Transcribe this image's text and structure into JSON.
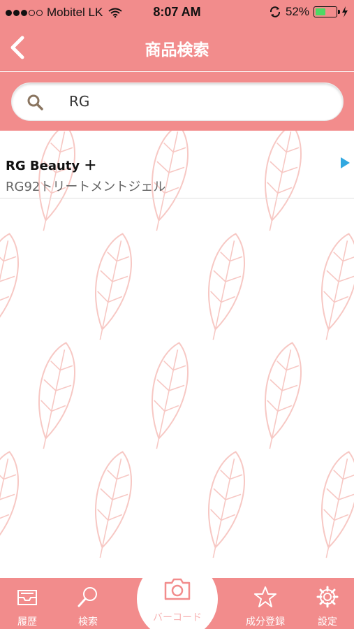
{
  "status_bar": {
    "carrier": "Mobitel LK",
    "time": "8:07 AM",
    "battery_percent": "52%",
    "battery_level": 0.52,
    "signal_bars": 3,
    "signal_max": 5
  },
  "nav": {
    "title": "商品検索",
    "back_icon": "chevron-left-icon"
  },
  "search": {
    "value": "RG",
    "icon": "search-icon"
  },
  "results": [
    {
      "brand": "RG Beauty ＋",
      "product": "RG92トリートメントジェル"
    }
  ],
  "tabs": [
    {
      "label": "履歴",
      "icon": "inbox-tray-icon"
    },
    {
      "label": "検索",
      "icon": "search-icon"
    },
    {
      "label": "バーコード",
      "icon": "camera-icon"
    },
    {
      "label": "成分登録",
      "icon": "star-icon"
    },
    {
      "label": "設定",
      "icon": "gear-icon"
    }
  ],
  "colors": {
    "accent": "#f28c8c",
    "arrow": "#31a8e0",
    "battery": "#4cd964",
    "pattern": "#f7c8c4"
  }
}
